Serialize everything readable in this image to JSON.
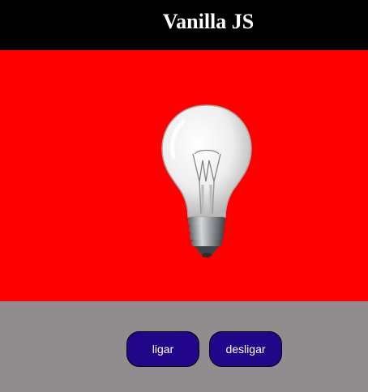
{
  "header": {
    "title": "Vanilla JS"
  },
  "stage": {
    "background": "#ff0000",
    "image_icon": "light-bulb-icon"
  },
  "controls": {
    "background": "#918c8e",
    "on_label": "ligar",
    "off_label": "desligar",
    "button_color": "#22068a"
  }
}
